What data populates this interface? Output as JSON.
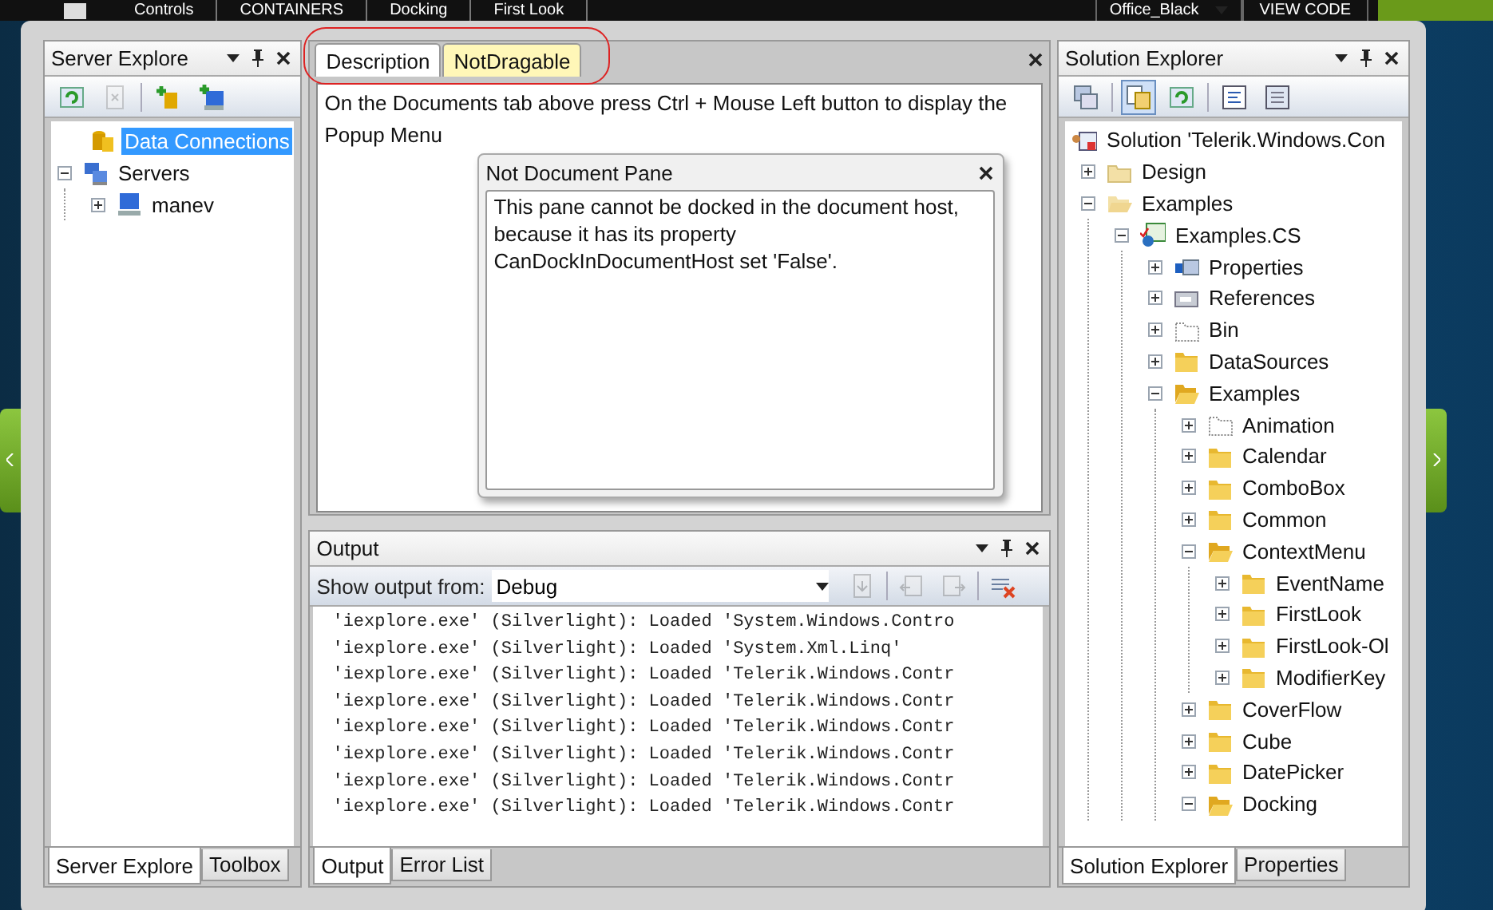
{
  "top_bar": {
    "breadcrumb": [
      "Controls",
      "CONTAINERS",
      "Docking",
      "First Look"
    ],
    "theme": "Office_Black",
    "view_code": "VIEW CODE"
  },
  "server_explorer": {
    "title": "Server Explore",
    "toolbar": [
      {
        "disabled": false
      },
      {
        "disabled": true
      },
      {
        "disabled": false
      },
      {
        "disabled": false
      }
    ],
    "tree": [
      {
        "label": "Data Connections",
        "kind": "database",
        "selected": true
      },
      {
        "label": "Servers",
        "kind": "servers",
        "selected": false,
        "expanded": true,
        "children": [
          {
            "label": "manev",
            "kind": "computer",
            "selected": false,
            "expanded": false
          }
        ]
      }
    ],
    "tabs": [
      {
        "label": "Server Explore",
        "selected": true
      },
      {
        "label": "Toolbox",
        "selected": false
      }
    ]
  },
  "documents": {
    "tabs": [
      {
        "label": "Description",
        "selected": true,
        "highlighted": false
      },
      {
        "label": "NotDragable",
        "selected": false,
        "highlighted": true
      }
    ],
    "text": "On the Documents tab above press Ctrl + Mouse Left button to display the Popup Menu"
  },
  "popup": {
    "title": "Not Document Pane",
    "text": "This pane cannot be docked in the document host, because it has its property CanDockInDocumentHost set 'False'."
  },
  "output": {
    "title": "Output",
    "source_label": "Show output from:",
    "source": "Debug",
    "toolbar": [
      {
        "disabled": true
      },
      {
        "disabled": true
      },
      {
        "disabled": true
      },
      {
        "disabled": false
      }
    ],
    "lines": [
      "'iexplore.exe' (Silverlight): Loaded 'System.Windows.Contro",
      "'iexplore.exe' (Silverlight): Loaded 'System.Xml.Linq'",
      "'iexplore.exe' (Silverlight): Loaded 'Telerik.Windows.Contr",
      "'iexplore.exe' (Silverlight): Loaded 'Telerik.Windows.Contr",
      "'iexplore.exe' (Silverlight): Loaded 'Telerik.Windows.Contr",
      "'iexplore.exe' (Silverlight): Loaded 'Telerik.Windows.Contr",
      "'iexplore.exe' (Silverlight): Loaded 'Telerik.Windows.Contr",
      "'iexplore.exe' (Silverlight): Loaded 'Telerik.Windows.Contr"
    ],
    "tabs": [
      {
        "label": "Output",
        "selected": true
      },
      {
        "label": "Error List",
        "selected": false
      }
    ]
  },
  "solution_explorer": {
    "title": "Solution Explorer",
    "toolbar": [
      {
        "pressed": false
      },
      {
        "pressed": true
      },
      {
        "pressed": false
      },
      {
        "pressed": false
      },
      {
        "pressed": false
      }
    ],
    "tree": [
      {
        "label": "Solution 'Telerik.Windows.Con",
        "kind": "solution",
        "children": [
          {
            "label": "Design",
            "kind": "folder-light",
            "expanded": false
          },
          {
            "label": "Examples",
            "kind": "folder-light-open",
            "expanded": true,
            "children": [
              {
                "label": "Examples.CS",
                "kind": "project",
                "expanded": true,
                "children": [
                  {
                    "label": "Properties",
                    "kind": "properties",
                    "expanded": false
                  },
                  {
                    "label": "References",
                    "kind": "references",
                    "expanded": false
                  },
                  {
                    "label": "Bin",
                    "kind": "empty-folder",
                    "expanded": false
                  },
                  {
                    "label": "DataSources",
                    "kind": "folder",
                    "expanded": false
                  },
                  {
                    "label": "Examples",
                    "kind": "folder-open",
                    "expanded": true,
                    "children": [
                      {
                        "label": "Animation",
                        "kind": "empty-folder",
                        "expanded": false
                      },
                      {
                        "label": "Calendar",
                        "kind": "folder",
                        "expanded": false
                      },
                      {
                        "label": "ComboBox",
                        "kind": "folder",
                        "expanded": false
                      },
                      {
                        "label": "Common",
                        "kind": "folder",
                        "expanded": false
                      },
                      {
                        "label": "ContextMenu",
                        "kind": "folder-open",
                        "expanded": true,
                        "children": [
                          {
                            "label": "EventName",
                            "kind": "folder",
                            "expanded": false
                          },
                          {
                            "label": "FirstLook",
                            "kind": "folder",
                            "expanded": false
                          },
                          {
                            "label": "FirstLook-Ol",
                            "kind": "folder",
                            "expanded": false
                          },
                          {
                            "label": "ModifierKey",
                            "kind": "folder",
                            "expanded": false
                          }
                        ]
                      },
                      {
                        "label": "CoverFlow",
                        "kind": "folder",
                        "expanded": false
                      },
                      {
                        "label": "Cube",
                        "kind": "folder",
                        "expanded": false
                      },
                      {
                        "label": "DatePicker",
                        "kind": "folder",
                        "expanded": false
                      },
                      {
                        "label": "Docking",
                        "kind": "folder-open",
                        "expanded": true
                      }
                    ]
                  }
                ]
              }
            ]
          }
        ]
      }
    ],
    "tabs": [
      {
        "label": "Solution Explorer",
        "selected": true
      },
      {
        "label": "Properties",
        "selected": false
      }
    ]
  }
}
